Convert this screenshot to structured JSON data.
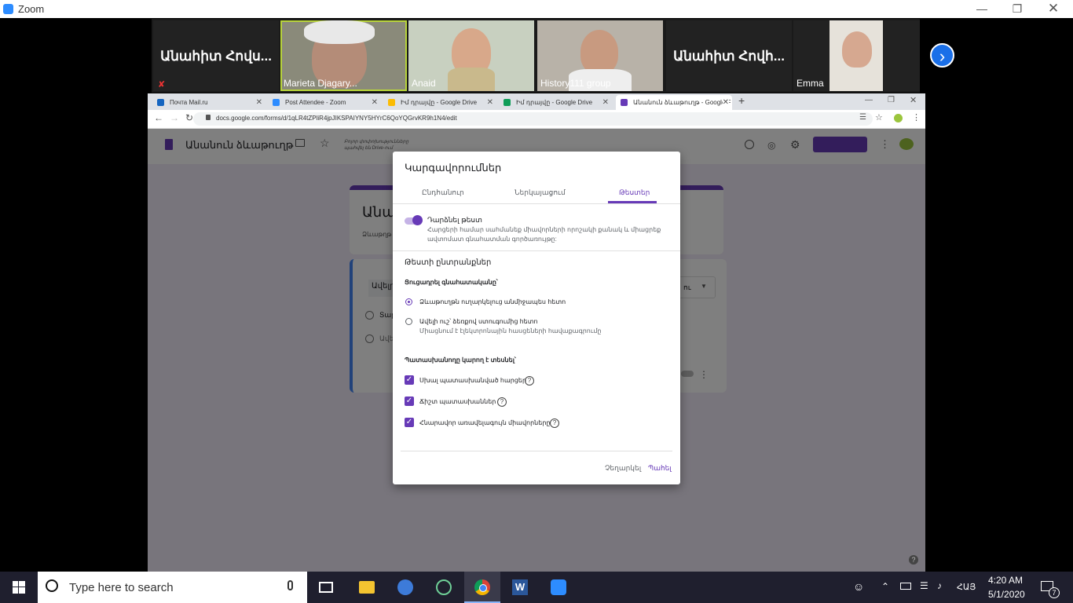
{
  "zoom": {
    "title": "Zoom",
    "participants": [
      {
        "name": "Անահիտ Հովս..."
      },
      {
        "name": "Marieta Djagary..."
      },
      {
        "name": "Anaid"
      },
      {
        "name": "History111 group"
      },
      {
        "name": "Անահիտ Հովհ..."
      },
      {
        "name": "Emma"
      }
    ]
  },
  "browser": {
    "tabs": [
      {
        "label": "Почта Mail.ru"
      },
      {
        "label": "Post Attendee - Zoom"
      },
      {
        "label": "Իմ դրայվը - Google Drive"
      },
      {
        "label": "Իմ դրայվը - Google Drive"
      },
      {
        "label": "Անանուն ձևաթուղթ - Google F"
      }
    ],
    "url": "docs.google.com/forms/d/1qLR4tZPliR4jpJIKSPAIYNY5HYrC6QoYQGrvKR9h1N4/edit"
  },
  "forms": {
    "doc_title": "Անանուն ձևաթուղթ",
    "saved_note_1": "Բոլոր փոփոխությունները",
    "saved_note_2": "պահվել են Drive-ում",
    "title_partial": "Անա",
    "desc_partial": "Ձևաթղթ",
    "question_partial": "Ավելր",
    "option1_partial": "Տարբ",
    "option2_partial": "Ավել",
    "type_partial": "ու"
  },
  "dialog": {
    "title": "Կարգավորումներ",
    "tabs": [
      "Ընդհանուր",
      "Ներկայացում",
      "Թեստեր"
    ],
    "toggle_label": "Դարձնել թեստ",
    "toggle_desc_1": "Հարցերի համար սահմանեք միավորների որոշակի քանակ և միացրեք",
    "toggle_desc_2": "ավտոմատ գնահատման գործառույթը:",
    "options_heading": "Թեստի ընտրանքներ",
    "release_heading": "Ցուցադրել գնահատականը՝",
    "release_opt1": "Ձևաթուղթն ուղարկելուց անմիջապես հետո",
    "release_opt2": "Ավելի ուշ՝ ձեռքով ստուգումից հետո",
    "release_opt2_note": "Միացնում է էլեկտրոնային հասցեների հավաքագրումը",
    "see_heading": "Պատասխանողը կարող է տեսնել՝",
    "see_opt1": "Սխալ պատասխանված հարցեր",
    "see_opt2": "Ճիշտ պատասխաններ",
    "see_opt3": "Հնարավոր առավելագույն միավորները",
    "cancel": "Չեղարկել",
    "save": "Պահել"
  },
  "taskbar": {
    "search_placeholder": "Type here to search",
    "lang": "ՀԱՅ",
    "time": "4:20 AM",
    "date": "5/1/2020",
    "notifications": "7"
  }
}
